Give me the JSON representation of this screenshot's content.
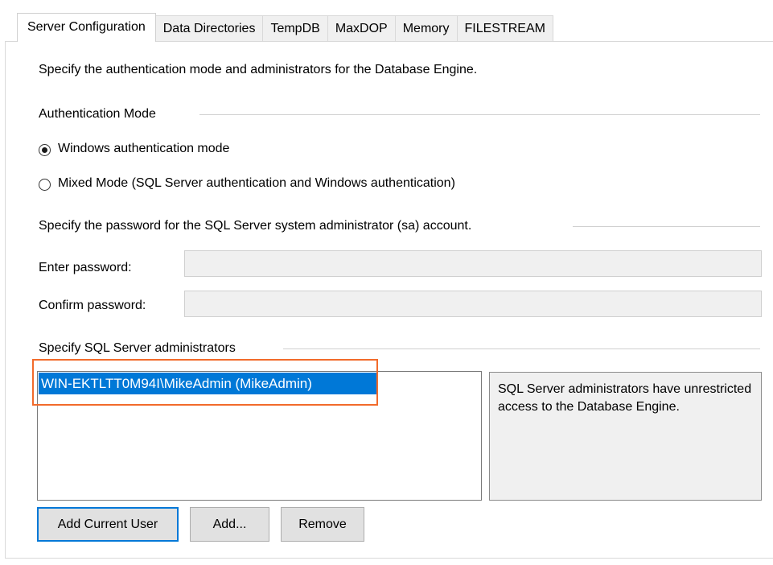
{
  "tabs": [
    {
      "label": "Server Configuration",
      "active": true
    },
    {
      "label": "Data Directories",
      "active": false
    },
    {
      "label": "TempDB",
      "active": false
    },
    {
      "label": "MaxDOP",
      "active": false
    },
    {
      "label": "Memory",
      "active": false
    },
    {
      "label": "FILESTREAM",
      "active": false
    }
  ],
  "description": "Specify the authentication mode and administrators for the Database Engine.",
  "auth": {
    "group_title": "Authentication Mode",
    "options": [
      {
        "label": "Windows authentication mode",
        "selected": true
      },
      {
        "label": "Mixed Mode (SQL Server authentication and Windows authentication)",
        "selected": false
      }
    ]
  },
  "password": {
    "group_title": "Specify the password for the SQL Server system administrator (sa) account.",
    "enter_label": "Enter password:",
    "confirm_label": "Confirm password:",
    "enter_value": "",
    "confirm_value": ""
  },
  "admins": {
    "group_title": "Specify SQL Server administrators",
    "items": [
      "WIN-EKTLTT0M94I\\MikeAdmin (MikeAdmin)"
    ],
    "info_text": "SQL Server administrators have unrestricted access to the Database Engine.",
    "buttons": {
      "add_current_user": "Add Current User",
      "add": "Add...",
      "remove": "Remove"
    }
  },
  "colors": {
    "selection": "#0078d7",
    "highlight_box": "#f26b2b",
    "disabled_field": "#f0f0f0"
  }
}
